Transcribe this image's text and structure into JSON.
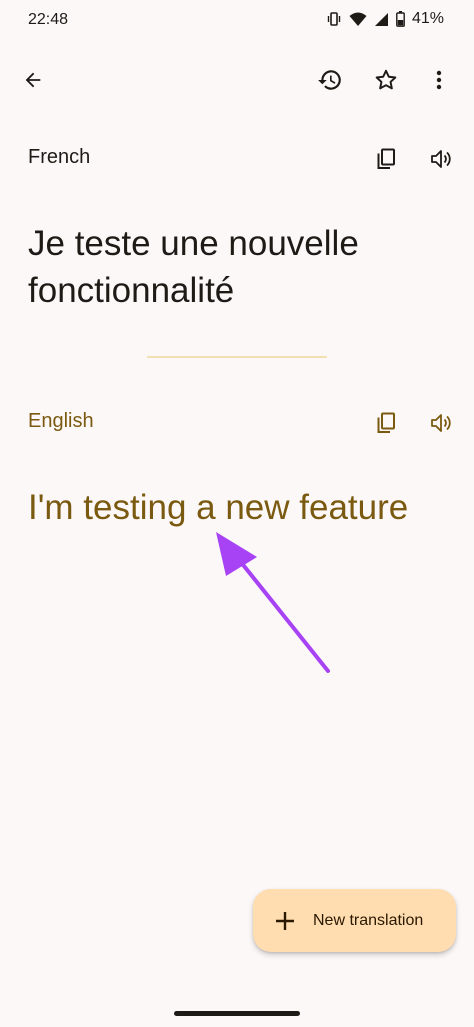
{
  "status_bar": {
    "time": "22:48",
    "battery_percent": "41%",
    "icons": [
      "vibrate-icon",
      "wifi-icon",
      "cell-signal-icon",
      "battery-icon"
    ]
  },
  "app_bar": {
    "icons": [
      "back-arrow-icon",
      "history-icon",
      "star-icon",
      "more-vert-icon"
    ]
  },
  "source": {
    "language": "French",
    "text": "Je teste une nouvelle fonctionnalité",
    "icons": [
      "copy-icon",
      "volume-icon"
    ]
  },
  "target": {
    "language": "English",
    "text": "I'm testing a new feature",
    "icons": [
      "copy-icon",
      "volume-icon"
    ]
  },
  "fab": {
    "label": "New translation",
    "icon": "plus-icon"
  },
  "colors": {
    "background": "#fdf8f8",
    "text_primary": "#1e1b16",
    "accent_text": "#7a5a10",
    "fab_background": "#ffddb0",
    "divider": "#f3dfb0",
    "annotation_arrow": "#a742f5"
  }
}
